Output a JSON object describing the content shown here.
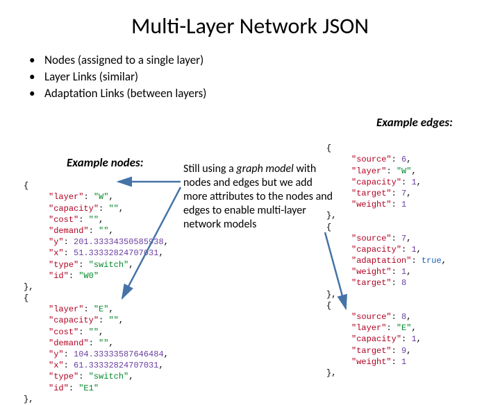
{
  "title": "Multi-Layer Network JSON",
  "bullets": {
    "b1": "Nodes (assigned to a single layer)",
    "b2": "Layer Links (similar)",
    "b3": "Adaptation Links (between layers)"
  },
  "labels": {
    "nodes": "Example nodes:",
    "edges": "Example edges:"
  },
  "desc": {
    "p1a": "Still using a ",
    "p1b": "graph model",
    "p1c": " with nodes and edges but we add more attributes to the nodes and edges to enable multi-layer network models"
  },
  "code_nodes": {
    "open": "{",
    "l1k": "\"layer\"",
    "l1v": "\"W\"",
    "l2k": "\"capacity\"",
    "l2v": "\"\"",
    "l3k": "\"cost\"",
    "l3v": "\"\"",
    "l4k": "\"demand\"",
    "l4v": "\"\"",
    "l5k": "\"y\"",
    "l5v": "201.33334350585938",
    "l6k": "\"x\"",
    "l6v": "51.33332824707031",
    "l7k": "\"type\"",
    "l7v": "\"switch\"",
    "l8k": "\"id\"",
    "l8v": "\"W0\"",
    "close1": "},",
    "open2": "{",
    "m1k": "\"layer\"",
    "m1v": "\"E\"",
    "m2k": "\"capacity\"",
    "m2v": "\"\"",
    "m3k": "\"cost\"",
    "m3v": "\"\"",
    "m4k": "\"demand\"",
    "m4v": "\"\"",
    "m5k": "\"y\"",
    "m5v": "104.33333587646484",
    "m6k": "\"x\"",
    "m6v": "61.33332824707031",
    "m7k": "\"type\"",
    "m7v": "\"switch\"",
    "m8k": "\"id\"",
    "m8v": "\"E1\"",
    "close2": "},"
  },
  "code_edges": {
    "open": "{",
    "a1k": "\"source\"",
    "a1v": "6",
    "a2k": "\"layer\"",
    "a2v": "\"W\"",
    "a3k": "\"capacity\"",
    "a3v": "1",
    "a4k": "\"target\"",
    "a4v": "7",
    "a5k": "\"weight\"",
    "a5v": "1",
    "close1": "},",
    "open2": "{",
    "b1k": "\"source\"",
    "b1v": "7",
    "b2k": "\"capacity\"",
    "b2v": "1",
    "b3k": "\"adaptation\"",
    "b3v": "true",
    "b4k": "\"weight\"",
    "b4v": "1",
    "b5k": "\"target\"",
    "b5v": "8",
    "close2": "},",
    "open3": "{",
    "c1k": "\"source\"",
    "c1v": "8",
    "c2k": "\"layer\"",
    "c2v": "\"E\"",
    "c3k": "\"capacity\"",
    "c3v": "1",
    "c4k": "\"target\"",
    "c4v": "9",
    "c5k": "\"weight\"",
    "c5v": "1",
    "close3": "},"
  }
}
